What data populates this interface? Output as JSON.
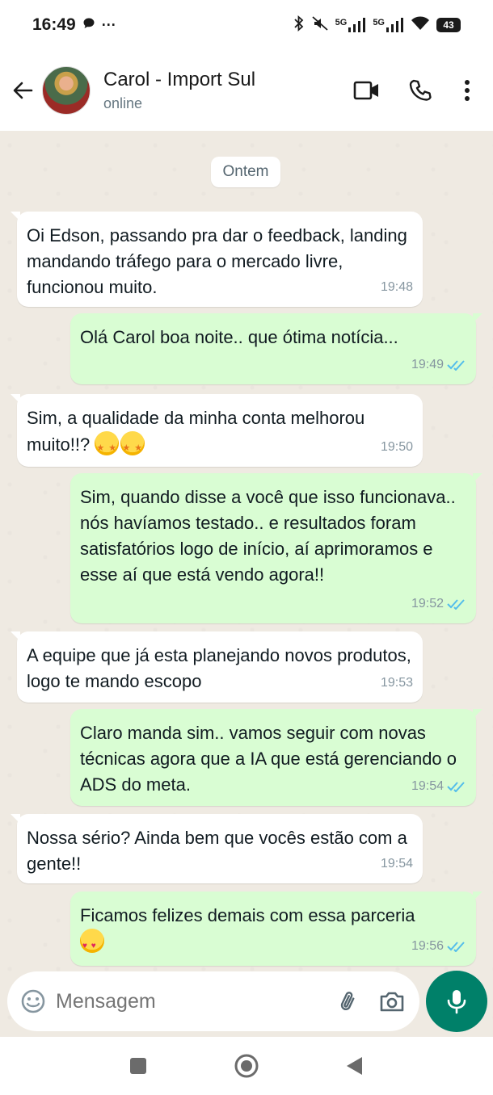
{
  "status_bar": {
    "time": "16:49",
    "more": "···",
    "network_1": "5G",
    "network_2": "5G",
    "battery": "43"
  },
  "header": {
    "contact_name": "Carol - Import Sul",
    "contact_status": "online"
  },
  "chat": {
    "date_label": "Ontem",
    "messages": [
      {
        "direction": "in",
        "text": "Oi Edson, passando pra dar o feedback, landing mandando tráfego para o mercado livre, funcionou muito.",
        "time": "19:48"
      },
      {
        "direction": "out",
        "text": "Olá Carol boa noite.. que ótima notícia...",
        "time": "19:49",
        "read": true
      },
      {
        "direction": "in",
        "text": "Sim, a qualidade da minha conta melhorou muito!!?",
        "emoji": "star-struck x2",
        "time": "19:50"
      },
      {
        "direction": "out",
        "text": "Sim, quando disse a você que isso funcionava.. nós havíamos testado.. e resultados foram satisfatórios logo de início, aí aprimoramos e esse aí que está vendo agora!!",
        "time": "19:52",
        "read": true
      },
      {
        "direction": "in",
        "text": "A equipe que já esta planejando novos produtos, logo te mando escopo",
        "time": "19:53"
      },
      {
        "direction": "out",
        "text": "Claro manda sim.. vamos seguir com novas técnicas agora que a IA que está gerenciando o ADS do meta.",
        "time": "19:54",
        "read": true
      },
      {
        "direction": "in",
        "text": "Nossa sério? Ainda bem que vocês estão com a gente!!",
        "time": "19:54"
      },
      {
        "direction": "out",
        "text": "Ficamos felizes demais com essa parceria",
        "emoji": "heart-eyes cat",
        "time": "19:56",
        "read": true
      }
    ]
  },
  "input": {
    "placeholder": "Mensagem"
  },
  "colors": {
    "accent": "#008069",
    "outgoing_bubble": "#d9fdd3",
    "incoming_bubble": "#ffffff",
    "chat_bg": "#efeae2",
    "read_tick": "#53bdeb"
  }
}
